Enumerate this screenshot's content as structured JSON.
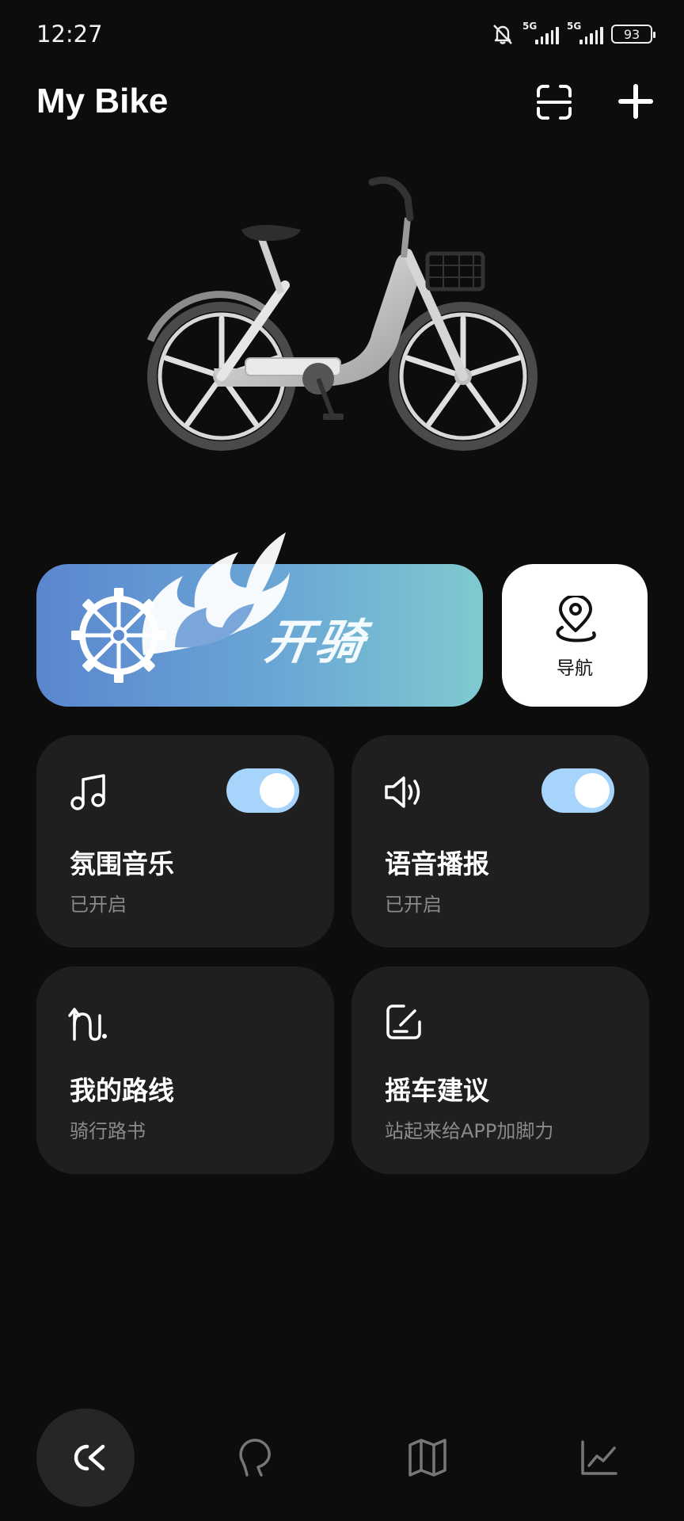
{
  "status_bar": {
    "time": "12:27",
    "network1": "5G",
    "network2": "5G",
    "battery": "93",
    "icons": [
      "bell-muted-icon",
      "signal-icon",
      "signal-icon",
      "battery-icon"
    ]
  },
  "header": {
    "title": "My Bike",
    "icons": [
      "scan-icon",
      "plus-icon"
    ]
  },
  "ride": {
    "label": "开骑",
    "icons": [
      "gear-icon",
      "flame-icon"
    ]
  },
  "navigation": {
    "label": "导航",
    "icon": "location-pin-icon"
  },
  "cards": [
    {
      "title": "氛围音乐",
      "subtitle": "已开启",
      "icon": "music-note-icon",
      "toggle_on": true
    },
    {
      "title": "语音播报",
      "subtitle": "已开启",
      "icon": "speaker-icon",
      "toggle_on": true
    },
    {
      "title": "我的路线",
      "subtitle": "骑行路书",
      "icon": "route-icon"
    },
    {
      "title": "摇车建议",
      "subtitle": "站起来给APP加脚力",
      "icon": "feedback-edit-icon"
    }
  ],
  "bottom_nav": {
    "tabs": [
      "ride-logo-icon",
      "chat-bubble-icon",
      "map-icon",
      "stats-chart-icon"
    ],
    "active_index": 0
  },
  "colors": {
    "background": "#0d0d0d",
    "card": "#1f1f1f",
    "toggle_on": "#a7d4fb",
    "ride_gradient_start": "#5b86cf",
    "ride_gradient_end": "#7fcacf"
  }
}
